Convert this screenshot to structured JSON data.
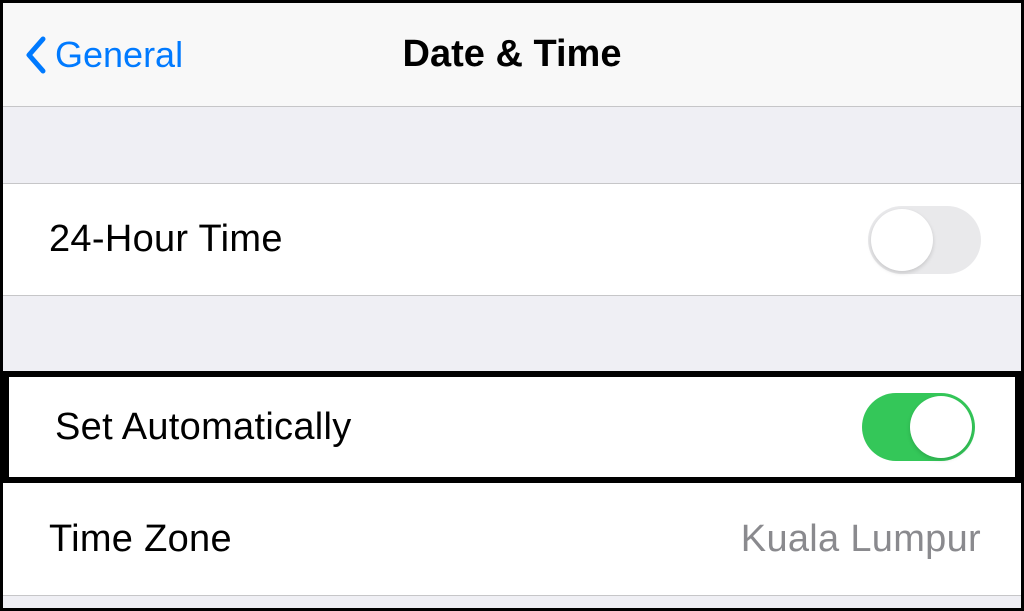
{
  "header": {
    "back_label": "General",
    "title": "Date & Time"
  },
  "rows": {
    "twentyFourHour": {
      "label": "24-Hour Time",
      "enabled": false
    },
    "setAutomatically": {
      "label": "Set Automatically",
      "enabled": true
    },
    "timeZone": {
      "label": "Time Zone",
      "value": "Kuala Lumpur"
    }
  }
}
